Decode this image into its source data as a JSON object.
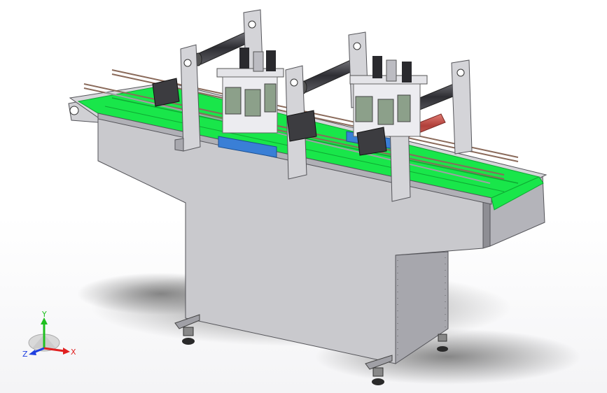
{
  "viewport": {
    "background": "#ffffff",
    "colors": {
      "frame": "#c8c8cc",
      "frame_dark": "#8e8e94",
      "frame_shadow": "#6f6f76",
      "belt": "#19e64a",
      "belt_dark": "#0fa833",
      "blue_block": "#3a7fd6",
      "roller": "#4a4a50",
      "motor": "#3c3c40",
      "red_rod": "#c0504a",
      "ground_shadow": "#8d8d8d"
    }
  },
  "triad": {
    "x_label": "X",
    "y_label": "Y",
    "z_label": "Z",
    "x_color": "#e02020",
    "y_color": "#20c020",
    "z_color": "#2040e0"
  }
}
